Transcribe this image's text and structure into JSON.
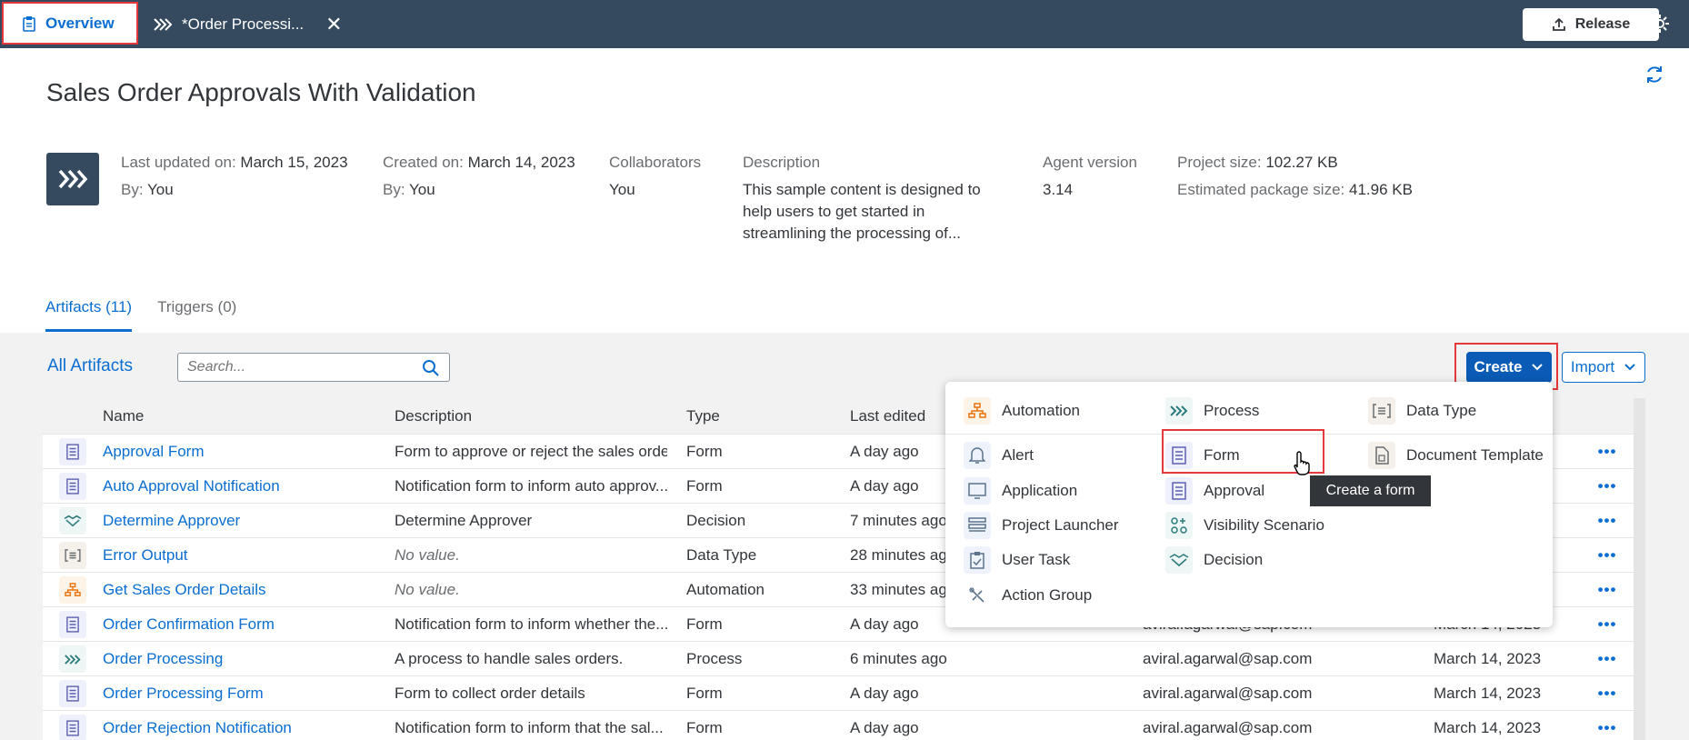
{
  "topbar": {
    "tab_overview": "Overview",
    "tab_process": "*Order Processi...",
    "release_label": "Release"
  },
  "project": {
    "title": "Sales Order Approvals With Validation",
    "last_updated_label": "Last updated on:",
    "last_updated_value": "March 15, 2023",
    "by_label": "By:",
    "by_value": "You",
    "created_label": "Created on:",
    "created_value": "March 14, 2023",
    "created_by_label": "By:",
    "created_by_value": "You",
    "collaborators_label": "Collaborators",
    "collaborators_value": "You",
    "description_label": "Description",
    "description_line1": "This sample content is designed to",
    "description_line2": "help users to get started in",
    "description_line3": "streamlining the processing of...",
    "agent_label": "Agent version",
    "agent_value": "3.14",
    "size_label": "Project size:",
    "size_value": "102.27 KB",
    "package_label": "Estimated package size:",
    "package_value": "41.96 KB"
  },
  "section_tabs": {
    "artifacts": "Artifacts (11)",
    "triggers": "Triggers (0)"
  },
  "toolbar": {
    "all_artifacts": "All Artifacts",
    "search_placeholder": "Search...",
    "create_label": "Create",
    "import_label": "Import"
  },
  "table": {
    "headers": {
      "name": "Name",
      "description": "Description",
      "type": "Type",
      "last_edited": "Last edited"
    },
    "rows": [
      {
        "icon": "form-icon",
        "name": "Approval Form",
        "description": "Form to approve or reject the sales order",
        "type": "Form",
        "edited": "A day ago",
        "user": "",
        "date": "",
        "more": "•••"
      },
      {
        "icon": "form-icon",
        "name": "Auto Approval Notification",
        "description": "Notification form to inform auto approv...",
        "type": "Form",
        "edited": "A day ago",
        "user": "",
        "date": "",
        "more": "•••"
      },
      {
        "icon": "decision-icon",
        "name": "Determine Approver",
        "description": "Determine Approver",
        "type": "Decision",
        "edited": "7 minutes ago",
        "user": "",
        "date": "",
        "more": "•••"
      },
      {
        "icon": "data-type-icon",
        "name": "Error Output",
        "description": "No value.",
        "type": "Data Type",
        "edited": "28 minutes ago",
        "user": "",
        "date": "",
        "more": "•••"
      },
      {
        "icon": "automation-icon",
        "name": "Get Sales Order Details",
        "description": "No value.",
        "type": "Automation",
        "edited": "33 minutes ago",
        "user": "",
        "date": "",
        "more": "•••"
      },
      {
        "icon": "form-icon",
        "name": "Order Confirmation Form",
        "description": "Notification form to inform whether the...",
        "type": "Form",
        "edited": "A day ago",
        "user": "aviral.agarwal@sap.com",
        "date": "March 14, 2023",
        "more": "•••"
      },
      {
        "icon": "process-icon",
        "name": "Order Processing",
        "description": "A process to handle sales orders.",
        "type": "Process",
        "edited": "6 minutes ago",
        "user": "aviral.agarwal@sap.com",
        "date": "March 14, 2023",
        "more": "•••"
      },
      {
        "icon": "form-icon",
        "name": "Order Processing Form",
        "description": "Form to collect order details",
        "type": "Form",
        "edited": "A day ago",
        "user": "aviral.agarwal@sap.com",
        "date": "March 14, 2023",
        "more": "•••"
      },
      {
        "icon": "form-icon",
        "name": "Order Rejection Notification",
        "description": "Notification form to inform that the sal...",
        "type": "Form",
        "edited": "A day ago",
        "user": "aviral.agarwal@sap.com",
        "date": "March 14, 2023",
        "more": "•••"
      }
    ]
  },
  "create_menu": {
    "automation": "Automation",
    "process": "Process",
    "data_type": "Data Type",
    "alert": "Alert",
    "form": "Form",
    "document_template": "Document Template",
    "application": "Application",
    "approval": "Approval",
    "project_launcher": "Project Launcher",
    "visibility_scenario": "Visibility Scenario",
    "user_task": "User Task",
    "decision": "Decision",
    "action_group": "Action Group",
    "tooltip": "Create a form"
  },
  "colors": {
    "shell": "#354a5f",
    "accent": "#0a6ed1",
    "highlight": "#e5383b",
    "automation": "#e9730c"
  }
}
